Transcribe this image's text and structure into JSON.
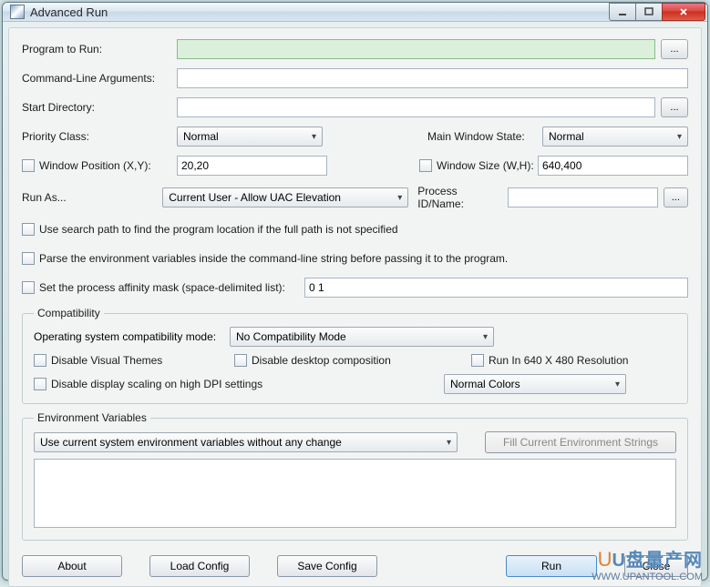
{
  "window": {
    "title": "Advanced Run"
  },
  "labels": {
    "program": "Program to Run:",
    "args": "Command-Line Arguments:",
    "startdir": "Start Directory:",
    "priority": "Priority Class:",
    "mainwin": "Main Window State:",
    "winpos": "Window Position (X,Y):",
    "winsize": "Window Size (W,H):",
    "runas": "Run As...",
    "procid": "Process ID/Name:",
    "searchpath": "Use search path to find the program location if the full path is not specified",
    "parseenv": "Parse the environment variables inside the command-line string before passing it to the program.",
    "affinity": "Set the process affinity mask (space-delimited list):",
    "compat_legend": "Compatibility",
    "osmode": "Operating system compatibility mode:",
    "disvisual": "Disable Visual Themes",
    "disdesktop": "Disable desktop composition",
    "run640": "Run In 640 X 480 Resolution",
    "disdpi": "Disable display scaling on high DPI settings",
    "envvar_legend": "Environment Variables",
    "fillenv": "Fill Current Environment Strings"
  },
  "values": {
    "program": "",
    "args": "",
    "startdir": "",
    "priority": "Normal",
    "mainwin": "Normal",
    "winpos": "20,20",
    "winsize": "640,400",
    "runas": "Current User - Allow UAC Elevation",
    "procid": "",
    "affinity": "0 1",
    "osmode": "No Compatibility Mode",
    "colors": "Normal Colors",
    "envmode": "Use current system environment variables without any change",
    "envtext": ""
  },
  "buttons": {
    "browse": "...",
    "about": "About",
    "loadcfg": "Load Config",
    "savecfg": "Save Config",
    "run": "Run",
    "close": "Close"
  },
  "watermark": {
    "line1": "U盘量产网",
    "line2": "WWW.UPANTOOL.COM"
  }
}
